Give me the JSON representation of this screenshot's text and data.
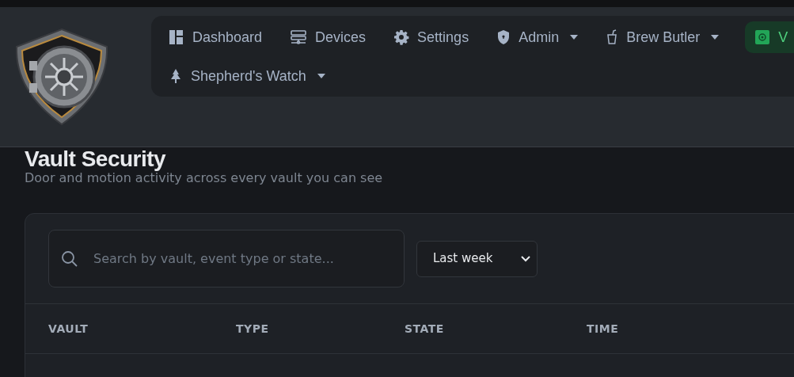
{
  "nav": {
    "rows": [
      [
        {
          "label": "Dashboard",
          "dropdown": false,
          "selected": false
        },
        {
          "label": "Devices",
          "dropdown": false,
          "selected": false
        },
        {
          "label": "Settings",
          "dropdown": false,
          "selected": false
        },
        {
          "label": "Admin",
          "dropdown": true,
          "selected": false
        },
        {
          "label": "Brew Butler",
          "dropdown": true,
          "selected": false
        },
        {
          "label": "V",
          "dropdown": false,
          "selected": true
        }
      ],
      [
        {
          "label": "Shepherd's Watch",
          "dropdown": true,
          "selected": false
        }
      ]
    ]
  },
  "page": {
    "title": "Vault Security",
    "subtitle": "Door and motion activity across every vault you can see"
  },
  "search": {
    "placeholder": "Search by vault, event type or state..."
  },
  "range_select": {
    "value": "Last week"
  },
  "table": {
    "columns": [
      "VAULT",
      "TYPE",
      "STATE",
      "TIME"
    ]
  }
}
